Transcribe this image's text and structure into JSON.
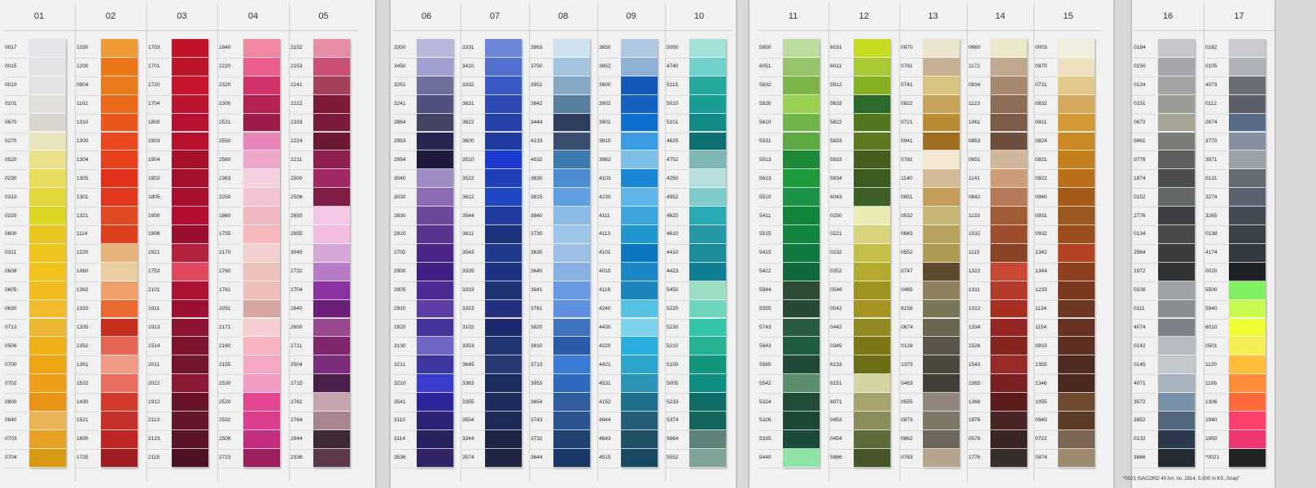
{
  "footnote": "*0021 ISACORD 40 Art. no. 2914, 5.000 m KS „Snap\"",
  "cards": [
    {
      "columns": [
        {
          "number": "01",
          "codes": [
            "0017",
            "0015",
            "0010",
            "0101",
            "0670",
            "0270",
            "0520",
            "0230",
            "0310",
            "0220",
            "0600",
            "0311",
            "0608",
            "0605",
            "0630",
            "0713",
            "0506",
            "0700",
            "0702",
            "0800",
            "0640",
            "0703",
            "0704"
          ],
          "colors": [
            "#e3e5ea",
            "#e2e3e5",
            "#e3e3e2",
            "#e0ded8",
            "#d8d5cd",
            "#e9e6bb",
            "#ebe08a",
            "#e8dc5f",
            "#e2d83c",
            "#dbd623",
            "#e9c520",
            "#eec41c",
            "#f1c11c",
            "#f2bb1e",
            "#f1bb2b",
            "#eeb532",
            "#f0b018",
            "#efa413",
            "#ee9e1a",
            "#eb9314",
            "#e8b457",
            "#e6a323",
            "#d89a14"
          ]
        },
        {
          "number": "02",
          "codes": [
            "1030",
            "1200",
            "0904",
            "1102",
            "1310",
            "1300",
            "1304",
            "1305",
            "1301",
            "1321",
            "1114",
            "1220",
            "1060",
            "1362",
            "1332",
            "1335",
            "1352",
            "1351",
            "1532",
            "1430",
            "1521",
            "1600",
            "1725"
          ],
          "colors": [
            "#ed9a37",
            "#ec7719",
            "#e87a1d",
            "#ea6a1a",
            "#e9571d",
            "#e9481e",
            "#e7421c",
            "#e2311b",
            "#e2381f",
            "#df4a24",
            "#dd3f1d",
            "#e8b37a",
            "#eacea2",
            "#ee9f6a",
            "#ea6b32",
            "#c52f1e",
            "#e36553",
            "#ef9a87",
            "#e86d5f",
            "#d33b2e",
            "#c7312d",
            "#c02623",
            "#9d1d22"
          ]
        },
        {
          "number": "03",
          "codes": [
            "1703",
            "1701",
            "1720",
            "1704",
            "1800",
            "1903",
            "1904",
            "1902",
            "1805",
            "1900",
            "1906",
            "1921",
            "1753",
            "2101",
            "1911",
            "1913",
            "1514",
            "2011",
            "2022",
            "1912",
            "2113",
            "2123",
            "2115"
          ],
          "colors": [
            "#c1142a",
            "#c0142b",
            "#c6152d",
            "#bd1430",
            "#b81030",
            "#b8102f",
            "#a60f2a",
            "#a30f2c",
            "#ab0f2e",
            "#b10e32",
            "#9a0f2d",
            "#b3223d",
            "#e14860",
            "#ad1234",
            "#9c1130",
            "#8c1430",
            "#7d142c",
            "#73162b",
            "#8c1734",
            "#6a1427",
            "#65152a",
            "#5a1428",
            "#4e1123"
          ]
        },
        {
          "number": "04",
          "codes": [
            "1840",
            "2220",
            "2320",
            "2300",
            "2521",
            "2550",
            "2560",
            "2363",
            "2250",
            "1860",
            "1755",
            "2170",
            "1760",
            "1761",
            "2051",
            "2171",
            "2160",
            "2155",
            "2530",
            "2520",
            "2532",
            "2508",
            "2723"
          ],
          "colors": [
            "#f088a0",
            "#ea5f8e",
            "#d2336d",
            "#b42050",
            "#9c1b4a",
            "#e887b7",
            "#eea7c9",
            "#f5d0e0",
            "#f5c3d4",
            "#f0b9c2",
            "#f7b8bb",
            "#f3d0d0",
            "#efc2bd",
            "#efbfbd",
            "#d8a7a3",
            "#f7cfd1",
            "#f7b4c0",
            "#f5a7c3",
            "#f49bc4",
            "#e6458f",
            "#da3e8c",
            "#c42c80",
            "#9d1f5e"
          ]
        },
        {
          "number": "05",
          "codes": [
            "2152",
            "2153",
            "2241",
            "2222",
            "2333",
            "2224",
            "2211",
            "2500",
            "2506",
            "2650",
            "2655",
            "3045",
            "2732",
            "2704",
            "2640",
            "2600",
            "2711",
            "2504",
            "2715",
            "2762",
            "2764",
            "2944",
            "2336"
          ],
          "colors": [
            "#e68ea4",
            "#c94f73",
            "#a5425a",
            "#7c1a37",
            "#7a1c39",
            "#6d1836",
            "#8f1f4e",
            "#a02963",
            "#7f1d47",
            "#f5c9e6",
            "#f1bce0",
            "#d6a6d7",
            "#b77cc8",
            "#8a34a4",
            "#6b1f78",
            "#9a4790",
            "#80276e",
            "#7b2c7a",
            "#4a1f4a",
            "#c6a4b0",
            "#a88490",
            "#3e2a35",
            "#5c3a4a"
          ]
        }
      ]
    },
    {
      "columns": [
        {
          "number": "06",
          "codes": [
            "3350",
            "3450",
            "3251",
            "3241",
            "2864",
            "2953",
            "2954",
            "3040",
            "3030",
            "2830",
            "2810",
            "2702",
            "2900",
            "2905",
            "2910",
            "2920",
            "3130",
            "3211",
            "3210",
            "3541",
            "3110",
            "3114",
            "3536"
          ],
          "colors": [
            "#b8b7dc",
            "#9f9fd1",
            "#6d6f9d",
            "#4f517f",
            "#444263",
            "#262650",
            "#1d1a3e",
            "#9f8cc7",
            "#8a6bb4",
            "#6b4a9e",
            "#5a3590",
            "#4b2585",
            "#3f2186",
            "#4a2c94",
            "#5d3da3",
            "#45339b",
            "#6f67c6",
            "#3b37a0",
            "#3a3ccc",
            "#2b279a",
            "#2c2476",
            "#26225e",
            "#312466"
          ]
        },
        {
          "number": "07",
          "codes": [
            "3331",
            "3410",
            "3332",
            "3631",
            "3622",
            "3600",
            "3510",
            "3522",
            "3612",
            "3544",
            "3611",
            "3543",
            "3335",
            "3333",
            "3323",
            "3102",
            "3353",
            "3645",
            "3363",
            "3355",
            "3554",
            "3344",
            "3574"
          ],
          "colors": [
            "#6b86d6",
            "#5270d0",
            "#3a59c4",
            "#2d4ab4",
            "#2540a8",
            "#1d3aa2",
            "#1c39d0",
            "#1f3fb7",
            "#2047c3",
            "#1e3b9d",
            "#1c327e",
            "#213a8e",
            "#1d3283",
            "#1e3274",
            "#22307e",
            "#1d2a70",
            "#22356e",
            "#273a74",
            "#1b2b5c",
            "#1d2c5d",
            "#1b2a54",
            "#1a2546",
            "#1e2540"
          ]
        },
        {
          "number": "08",
          "codes": [
            "3963",
            "3750",
            "3951",
            "3842",
            "3444",
            "4133",
            "4032",
            "3830",
            "3815",
            "3840",
            "3730",
            "3630",
            "3640",
            "3641",
            "3761",
            "3820",
            "3810",
            "3713",
            "3953",
            "3654",
            "3743",
            "3732",
            "3644"
          ],
          "colors": [
            "#cde1ef",
            "#a3c4de",
            "#87a8c5",
            "#5a7ea0",
            "#2e3f5d",
            "#3b4d70",
            "#3d7ab0",
            "#4d8cd0",
            "#5ea0e0",
            "#8bbbe4",
            "#9ec6ea",
            "#9dc0e5",
            "#88b0e2",
            "#6a9ae2",
            "#5f8fdf",
            "#3f73c0",
            "#2b5aa8",
            "#3a7ad6",
            "#2e6bbe",
            "#305da0",
            "#2a5590",
            "#1f4370",
            "#1a3866"
          ]
        },
        {
          "number": "09",
          "codes": [
            "3650",
            "3652",
            "3600",
            "3902",
            "3901",
            "3910",
            "3962",
            "4103",
            "4230",
            "4111",
            "4113",
            "4101",
            "4010",
            "4116",
            "4240",
            "4430",
            "4220",
            "4421",
            "4531",
            "4152",
            "4644",
            "4643",
            "4515"
          ],
          "colors": [
            "#aec6e0",
            "#8eb0d6",
            "#1458b8",
            "#1362c4",
            "#0d6fcf",
            "#3a9be2",
            "#7cbfe8",
            "#1b86d4",
            "#5cb7e8",
            "#3aa6dc",
            "#2097cd",
            "#0c77be",
            "#1b87c6",
            "#1a83b8",
            "#55c2e6",
            "#7cd3ea",
            "#2aaee0",
            "#2aa4cc",
            "#2b93b8",
            "#1e6f8c",
            "#245e76",
            "#1f5066",
            "#174a62"
          ]
        },
        {
          "number": "10",
          "codes": [
            "5050",
            "4740",
            "5115",
            "5010",
            "5101",
            "4625",
            "4752",
            "4250",
            "4952",
            "4620",
            "4610",
            "4410",
            "4423",
            "5450",
            "5220",
            "5230",
            "5210",
            "5100",
            "5005",
            "5233",
            "5374",
            "5664",
            "5552"
          ],
          "colors": [
            "#a5e0d9",
            "#6fd1c8",
            "#25a99d",
            "#1a9e93",
            "#138a84",
            "#0f6f72",
            "#7fb6b6",
            "#b7dddd",
            "#7dcbcb",
            "#2aa8b3",
            "#2598a8",
            "#1b8c99",
            "#117f92",
            "#9fdcc4",
            "#6fd6c0",
            "#32c6a8",
            "#25b192",
            "#11957d",
            "#118e83",
            "#0e6d66",
            "#15675e",
            "#5d837a",
            "#80a298"
          ]
        }
      ]
    },
    {
      "columns": [
        {
          "number": "11",
          "codes": [
            "5650",
            "6051",
            "5832",
            "5830",
            "5610",
            "5531",
            "5513",
            "5613",
            "5510",
            "5411",
            "5515",
            "5415",
            "5422",
            "5944",
            "5555",
            "5743",
            "5643",
            "5565",
            "5542",
            "5324",
            "5326",
            "5335",
            "5440"
          ],
          "colors": [
            "#bddb9f",
            "#98c468",
            "#7db44a",
            "#98d04f",
            "#6fb54a",
            "#5ea843",
            "#1c8a36",
            "#1e9a3c",
            "#1b9545",
            "#11853a",
            "#128641",
            "#117841",
            "#0f6b3c",
            "#2d4a33",
            "#264931",
            "#285c3e",
            "#1f5d3d",
            "#1f4a35",
            "#5a8e6c",
            "#214c36",
            "#1b4735",
            "#1a4a3c",
            "#8ee3a6"
          ]
        },
        {
          "number": "12",
          "codes": [
            "6031",
            "6011",
            "5912",
            "5633",
            "5822",
            "5833",
            "5933",
            "5934",
            "6043",
            "0250",
            "0221",
            "0232",
            "0352",
            "0546",
            "0542",
            "0442",
            "0345",
            "6133",
            "6151",
            "6071",
            "0453",
            "0454",
            "5866"
          ],
          "colors": [
            "#c6dc22",
            "#a9c935",
            "#86b022",
            "#2c6a2a",
            "#53771e",
            "#5a7a22",
            "#435f1e",
            "#3c5b21",
            "#3e5f26",
            "#ebeab4",
            "#d8d37c",
            "#c4bf48",
            "#b4a92f",
            "#9e9221",
            "#a5941f",
            "#928920",
            "#7e7716",
            "#6d6d15",
            "#d6d3a5",
            "#a6a46c",
            "#8a8c5a",
            "#5d6c38",
            "#465628"
          ]
        },
        {
          "number": "13",
          "codes": [
            "0970",
            "0761",
            "0741",
            "0822",
            "0721",
            "0941",
            "0781",
            "1140",
            "0851",
            "0532",
            "0643",
            "0552",
            "0747",
            "0465",
            "6156",
            "0674",
            "0128",
            "1375",
            "0463",
            "0555",
            "0873",
            "0862",
            "0763"
          ],
          "colors": [
            "#ebe5cd",
            "#c5b393",
            "#d8c381",
            "#c8a35a",
            "#b98b33",
            "#a06d21",
            "#f1e8cf",
            "#d2bb94",
            "#c49b59",
            "#c6b778",
            "#b9a35c",
            "#ad9a4e",
            "#5c4a2e",
            "#8d7f5c",
            "#7a7456",
            "#6b6550",
            "#5b5549",
            "#4a4838",
            "#413e35",
            "#918677",
            "#7d7566",
            "#6e675b",
            "#b5a48f"
          ]
        },
        {
          "number": "14",
          "codes": [
            "0660",
            "1172",
            "0934",
            "1123",
            "1061",
            "0853",
            "0651",
            "1141",
            "0842",
            "1133",
            "1032",
            "1115",
            "1322",
            "1311",
            "1312",
            "1334",
            "1526",
            "1543",
            "1565",
            "1366",
            "1876",
            "0576",
            "1776"
          ],
          "colors": [
            "#ebe7c9",
            "#bfa88e",
            "#a5896e",
            "#8d6d55",
            "#7a5c48",
            "#6e4e3c",
            "#d1b79a",
            "#cc9d78",
            "#b47a55",
            "#a05c37",
            "#9e4d2d",
            "#8a4325",
            "#c94735",
            "#b43a2b",
            "#a82e22",
            "#952521",
            "#862420",
            "#9a2a25",
            "#7a2022",
            "#5b1d1c",
            "#472623",
            "#3a2420",
            "#382c2a"
          ]
        },
        {
          "number": "15",
          "codes": [
            "0003",
            "0870",
            "0731",
            "0832",
            "0811",
            "0824",
            "0821",
            "0922",
            "0940",
            "0931",
            "0932",
            "1342",
            "1344",
            "1233",
            "1134",
            "1154",
            "0933",
            "1355",
            "1346",
            "1055",
            "0945",
            "0722",
            "0874"
          ],
          "colors": [
            "#f1eee0",
            "#ece1bf",
            "#e2c98a",
            "#d4a85d",
            "#d49935",
            "#c98a23",
            "#c47e1c",
            "#b97019",
            "#a65a17",
            "#9a5a1d",
            "#9b4d1b",
            "#b64221",
            "#8f3d1f",
            "#7b3a20",
            "#6c3621",
            "#673023",
            "#5e2f23",
            "#4f2a20",
            "#4a281e",
            "#6e4a2e",
            "#5b3c29",
            "#7a6652",
            "#9e8b6f"
          ]
        }
      ]
    },
    {
      "columns": [
        {
          "number": "16",
          "codes": [
            "0184",
            "0150",
            "0124",
            "0151",
            "0672",
            "0861",
            "0776",
            "1874",
            "0152",
            "2776",
            "0134",
            "2564",
            "1972",
            "0108",
            "0111",
            "4074",
            "0142",
            "0145",
            "4071",
            "3572",
            "3852",
            "0132",
            "3666"
          ],
          "colors": [
            "#c7c5c9",
            "#a5a6aa",
            "#a1a4a2",
            "#9b9c96",
            "#a8a597",
            "#7c7d79",
            "#5f605e",
            "#4b4d4d",
            "#656868",
            "#3d3e42",
            "#49494c",
            "#3a3b3d",
            "#303234",
            "#9fa3a6",
            "#8a8d91",
            "#7d8288",
            "#b6bcc1",
            "#c2c7cc",
            "#a8b3c0",
            "#7892aa",
            "#52677c",
            "#2a3a4c",
            "#232b34"
          ]
        },
        {
          "number": "17",
          "codes": [
            "0182",
            "0105",
            "4073",
            "0112",
            "2674",
            "3770",
            "3971",
            "0131",
            "3274",
            "3265",
            "0138",
            "4174",
            "0020",
            "5500",
            "5940",
            "6010",
            "0501",
            "1120",
            "1106",
            "1306",
            "1940",
            "1950",
            "*0021"
          ],
          "colors": [
            "#c9cbd1",
            "#aeb1b7",
            "#6b6e77",
            "#5d6068",
            "#5a6b88",
            "#8590a0",
            "#9aa2aa",
            "#646b72",
            "#5a6470",
            "#444a54",
            "#3a4049",
            "#303a40",
            "#1d2226",
            "#7ff060",
            "#c9f84e",
            "#efff36",
            "#f5ee54",
            "#ffbd3a",
            "#ff8e3a",
            "#ff6a3a",
            "#ff3f6e",
            "#f03670",
            "#242424"
          ]
        }
      ]
    }
  ]
}
